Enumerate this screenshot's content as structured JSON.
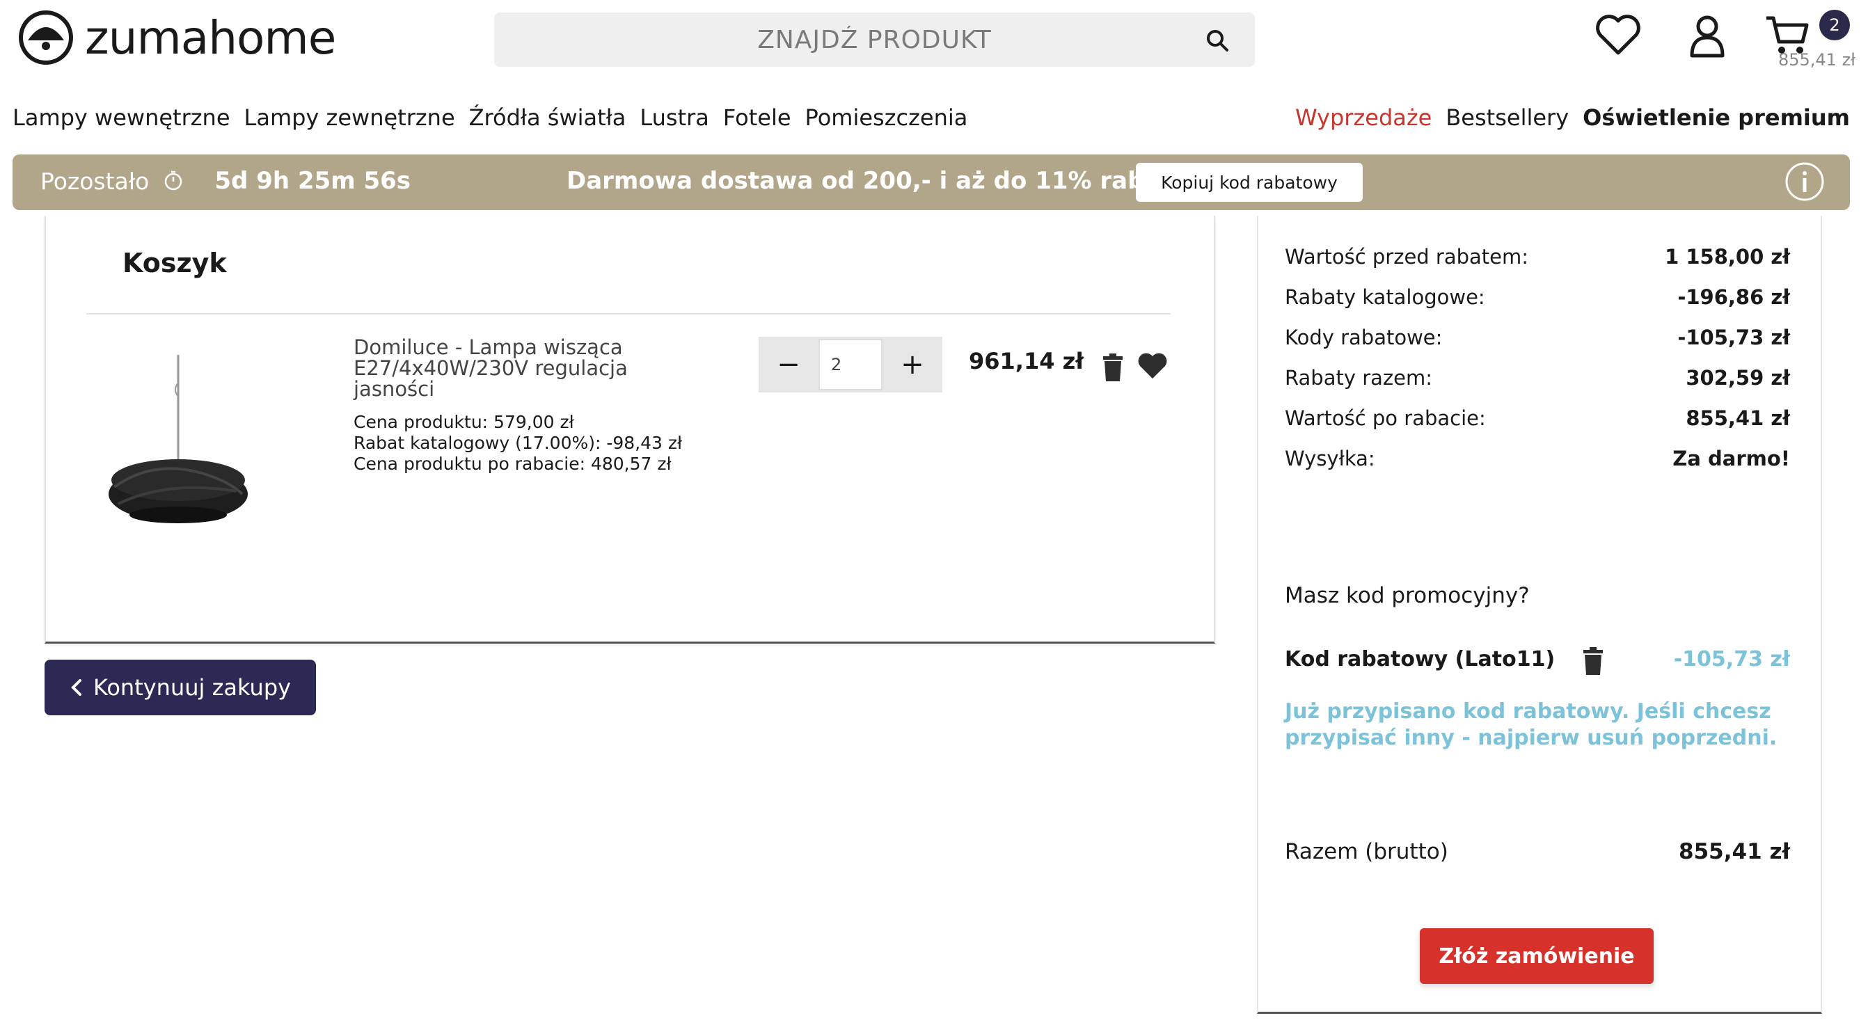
{
  "brand": {
    "name": "zumahome"
  },
  "search": {
    "placeholder": "ZNAJDŹ PRODUKT"
  },
  "header": {
    "cart_count": "2",
    "cart_total": "855,41 zł"
  },
  "nav": {
    "left": [
      "Lampy wewnętrzne",
      "Lampy zewnętrzne",
      "Źródła światła",
      "Lustra",
      "Fotele",
      "Pomieszczenia"
    ],
    "sale": "Wyprzedaże",
    "bestsellers": "Bestsellery",
    "premium": "Oświetlenie premium"
  },
  "promo_bar": {
    "remaining_label": "Pozostało",
    "timer": "5d 9h 25m 56s",
    "message": "Darmowa dostawa od 200,- i aż do 11% rabatu!",
    "copy_button": "Kopiuj kod rabatowy"
  },
  "cart": {
    "title": "Koszyk",
    "items": [
      {
        "name": "Domiluce - Lampa wisząca E27/4x40W/230V regulacja jasności",
        "price_line": "Cena produktu: 579,00 zł",
        "discount_line": "Rabat katalogowy (17.00%): -98,43 zł",
        "discounted_line": "Cena produktu po rabacie: 480,57 zł",
        "quantity": "2",
        "total": "961,14 zł"
      }
    ],
    "continue_button": "Kontynuuj zakupy"
  },
  "summary": {
    "rows": [
      {
        "label": "Wartość przed rabatem:",
        "value": "1 158,00 zł"
      },
      {
        "label": "Rabaty katalogowe:",
        "value": "-196,86 zł"
      },
      {
        "label": "Kody rabatowe:",
        "value": "-105,73 zł"
      },
      {
        "label": "Rabaty razem:",
        "value": "302,59 zł"
      },
      {
        "label": "Wartość po rabacie:",
        "value": "855,41 zł"
      },
      {
        "label": "Wysyłka:",
        "value": "Za darmo!"
      }
    ],
    "promo_question": "Masz kod promocyjny?",
    "code_label": "Kod rabatowy (Lato11)",
    "code_amount": "-105,73 zł",
    "code_message": "Już przypisano kod rabatowy. Jeśli chcesz przypisać inny - najpierw usuń poprzedni.",
    "total_label": "Razem (brutto)",
    "total_value": "855,41 zł",
    "order_button": "Złóż zamówienie"
  },
  "colors": {
    "accent_navy": "#2c2a54",
    "promo_bar": "#b2a68a",
    "sale_red": "#c8352c",
    "order_red": "#d6322b",
    "code_blue": "#7cc3d9"
  }
}
